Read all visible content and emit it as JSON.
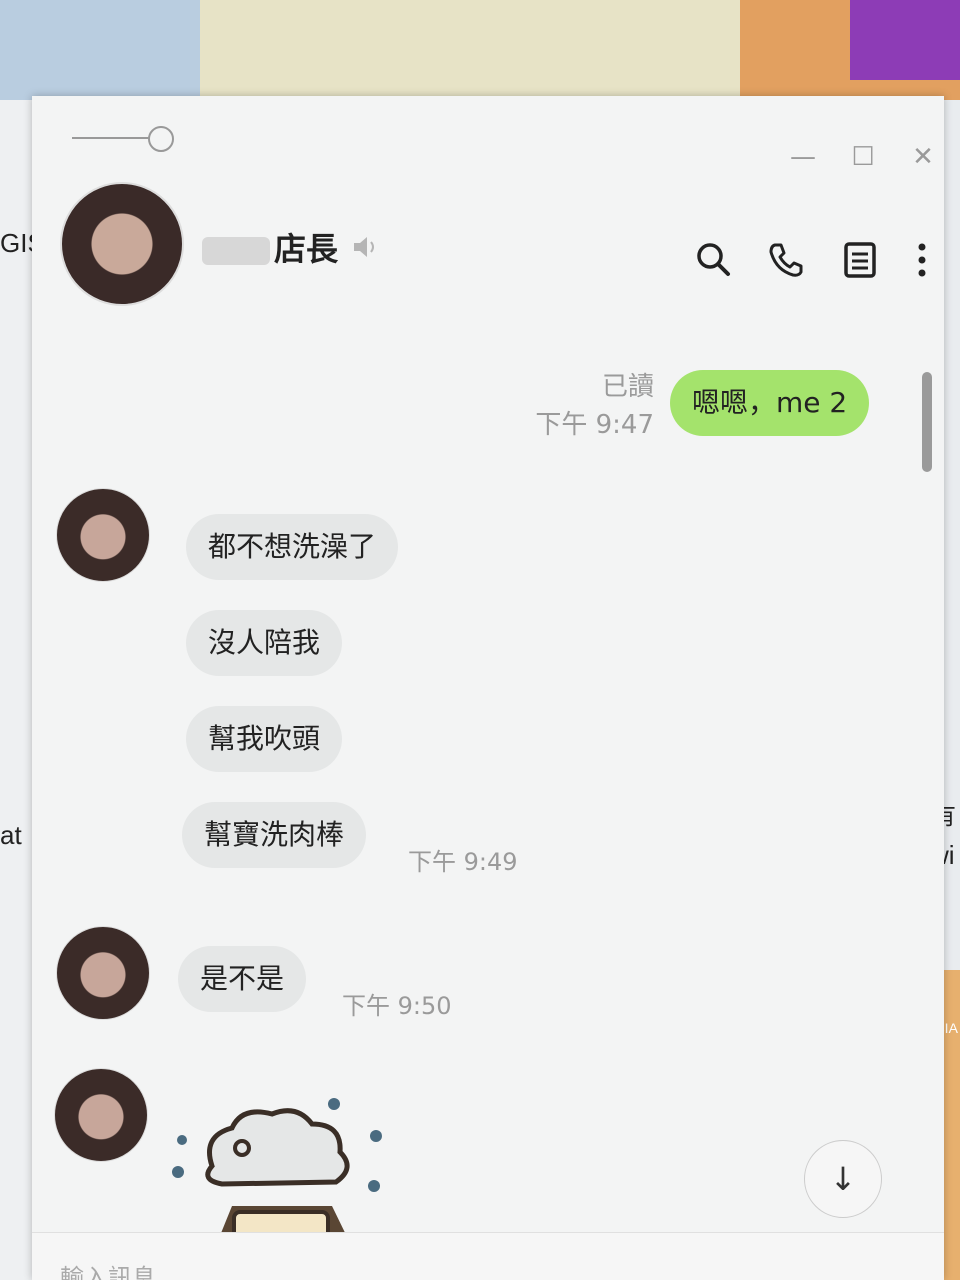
{
  "background": {
    "left_fragments": [
      "GIS",
      "at"
    ],
    "right_fragments": [
      "有",
      "wi",
      "SSIA"
    ]
  },
  "window": {
    "controls": {
      "minimize": "—",
      "maximize": "☐",
      "close": "✕"
    }
  },
  "header": {
    "chat_title": "店長",
    "speaker_icon": "speaker-icon",
    "actions": [
      {
        "icon": "search-icon"
      },
      {
        "icon": "phone-icon"
      },
      {
        "icon": "notes-icon"
      },
      {
        "icon": "more-icon"
      }
    ]
  },
  "messages": [
    {
      "from": "me",
      "text": "嗯嗯，me 2",
      "read": "已讀",
      "time": "下午 9:47"
    },
    {
      "from": "other",
      "text": "都不想洗澡了"
    },
    {
      "from": "other",
      "text": "沒人陪我"
    },
    {
      "from": "other",
      "text": "幫我吹頭"
    },
    {
      "from": "other",
      "text": "幫寶洗肉棒",
      "time": "下午 9:49"
    },
    {
      "from": "other",
      "text": "是不是",
      "time": "下午 9:50"
    },
    {
      "from": "other",
      "type": "sticker",
      "sticker": "sticker-image"
    }
  ],
  "scroll_down": "↓",
  "input": {
    "placeholder": "輸入訊息"
  },
  "colors": {
    "my_bubble": "#a4e36c",
    "other_bubble": "#e5e7e7"
  }
}
